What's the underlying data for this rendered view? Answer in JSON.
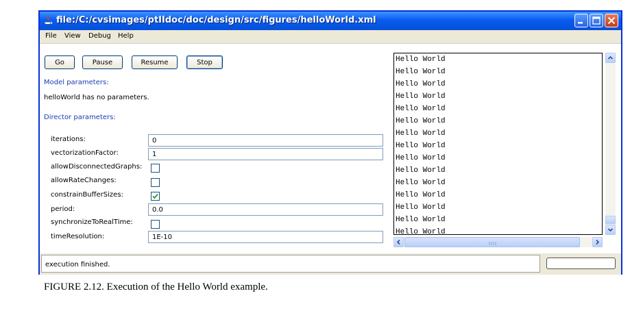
{
  "window": {
    "title": "file:/C:/cvsimages/ptIIdoc/doc/design/src/figures/helloWorld.xml",
    "colors": {
      "titlebar": "#0a5cf0",
      "section_label": "#1a3db0"
    }
  },
  "menu": [
    "File",
    "View",
    "Debug",
    "Help"
  ],
  "toolbar": {
    "buttons": [
      "Go",
      "Pause",
      "Resume",
      "Stop"
    ]
  },
  "model": {
    "heading": "Model parameters:",
    "message": "helloWorld has no parameters."
  },
  "director": {
    "heading": "Director parameters:",
    "params": [
      {
        "label": "iterations:",
        "type": "text",
        "value": "0"
      },
      {
        "label": "vectorizationFactor:",
        "type": "text",
        "value": "1"
      },
      {
        "label": "allowDisconnectedGraphs:",
        "type": "checkbox",
        "checked": false
      },
      {
        "label": "allowRateChanges:",
        "type": "checkbox",
        "checked": false
      },
      {
        "label": "constrainBufferSizes:",
        "type": "checkbox",
        "checked": true
      },
      {
        "label": "period:",
        "type": "text",
        "value": "0.0"
      },
      {
        "label": "synchronizeToRealTime:",
        "type": "checkbox",
        "checked": false
      },
      {
        "label": "timeResolution:",
        "type": "text",
        "value": "1E-10"
      }
    ]
  },
  "output": {
    "lines": [
      "Hello World",
      "Hello World",
      "Hello World",
      "Hello World",
      "Hello World",
      "Hello World",
      "Hello World",
      "Hello World",
      "Hello World",
      "Hello World",
      "Hello World",
      "Hello World",
      "Hello World",
      "Hello World",
      "Hello World"
    ]
  },
  "status": {
    "text": "execution finished."
  },
  "caption": "FIGURE 2.12.  Execution of the Hello World example."
}
